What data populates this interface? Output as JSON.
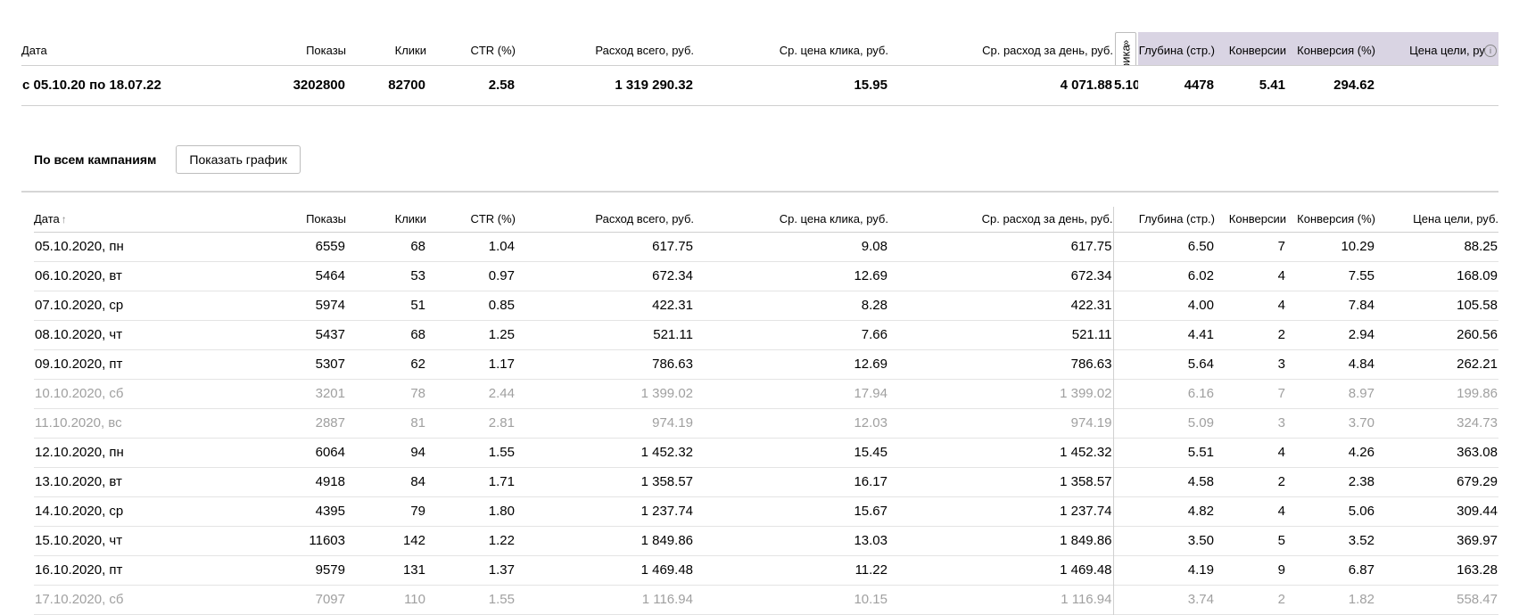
{
  "columns": {
    "date": "Дата",
    "shows": "Показы",
    "clicks": "Клики",
    "ctr": "CTR (%)",
    "spend": "Расход всего, руб.",
    "cpc": "Ср. цена клика, руб.",
    "daily_spend": "Ср. расход за день, руб.",
    "depth": "Глубина (стр.)",
    "conversions": "Конверсии",
    "conv_rate": "Конверсия (%)",
    "goal_price": "Цена цели, руб."
  },
  "metrika_tab": {
    "label": "Метрика",
    "arrow": "»"
  },
  "summary": {
    "period": "с 05.10.20 по 18.07.22",
    "shows": "3202800",
    "clicks": "82700",
    "ctr": "2.58",
    "spend": "1 319 290.32",
    "cpc": "15.95",
    "daily_spend": "4 071.88",
    "depth": "5.10",
    "conversions": "4478",
    "conv_rate": "5.41",
    "goal_price": "294.62"
  },
  "section": {
    "title": "По всем кампаниям",
    "show_chart_label": "Показать график",
    "sort_arrow": "↑"
  },
  "info_icon": "i",
  "rows": [
    {
      "date": "05.10.2020, пн",
      "shows": "6559",
      "clicks": "68",
      "ctr": "1.04",
      "spend": "617.75",
      "cpc": "9.08",
      "daily_spend": "617.75",
      "depth": "6.50",
      "conversions": "7",
      "conv_rate": "10.29",
      "goal_price": "88.25",
      "weekend": false
    },
    {
      "date": "06.10.2020, вт",
      "shows": "5464",
      "clicks": "53",
      "ctr": "0.97",
      "spend": "672.34",
      "cpc": "12.69",
      "daily_spend": "672.34",
      "depth": "6.02",
      "conversions": "4",
      "conv_rate": "7.55",
      "goal_price": "168.09",
      "weekend": false
    },
    {
      "date": "07.10.2020, ср",
      "shows": "5974",
      "clicks": "51",
      "ctr": "0.85",
      "spend": "422.31",
      "cpc": "8.28",
      "daily_spend": "422.31",
      "depth": "4.00",
      "conversions": "4",
      "conv_rate": "7.84",
      "goal_price": "105.58",
      "weekend": false
    },
    {
      "date": "08.10.2020, чт",
      "shows": "5437",
      "clicks": "68",
      "ctr": "1.25",
      "spend": "521.11",
      "cpc": "7.66",
      "daily_spend": "521.11",
      "depth": "4.41",
      "conversions": "2",
      "conv_rate": "2.94",
      "goal_price": "260.56",
      "weekend": false
    },
    {
      "date": "09.10.2020, пт",
      "shows": "5307",
      "clicks": "62",
      "ctr": "1.17",
      "spend": "786.63",
      "cpc": "12.69",
      "daily_spend": "786.63",
      "depth": "5.64",
      "conversions": "3",
      "conv_rate": "4.84",
      "goal_price": "262.21",
      "weekend": false
    },
    {
      "date": "10.10.2020, сб",
      "shows": "3201",
      "clicks": "78",
      "ctr": "2.44",
      "spend": "1 399.02",
      "cpc": "17.94",
      "daily_spend": "1 399.02",
      "depth": "6.16",
      "conversions": "7",
      "conv_rate": "8.97",
      "goal_price": "199.86",
      "weekend": true
    },
    {
      "date": "11.10.2020, вс",
      "shows": "2887",
      "clicks": "81",
      "ctr": "2.81",
      "spend": "974.19",
      "cpc": "12.03",
      "daily_spend": "974.19",
      "depth": "5.09",
      "conversions": "3",
      "conv_rate": "3.70",
      "goal_price": "324.73",
      "weekend": true
    },
    {
      "date": "12.10.2020, пн",
      "shows": "6064",
      "clicks": "94",
      "ctr": "1.55",
      "spend": "1 452.32",
      "cpc": "15.45",
      "daily_spend": "1 452.32",
      "depth": "5.51",
      "conversions": "4",
      "conv_rate": "4.26",
      "goal_price": "363.08",
      "weekend": false
    },
    {
      "date": "13.10.2020, вт",
      "shows": "4918",
      "clicks": "84",
      "ctr": "1.71",
      "spend": "1 358.57",
      "cpc": "16.17",
      "daily_spend": "1 358.57",
      "depth": "4.58",
      "conversions": "2",
      "conv_rate": "2.38",
      "goal_price": "679.29",
      "weekend": false
    },
    {
      "date": "14.10.2020, ср",
      "shows": "4395",
      "clicks": "79",
      "ctr": "1.80",
      "spend": "1 237.74",
      "cpc": "15.67",
      "daily_spend": "1 237.74",
      "depth": "4.82",
      "conversions": "4",
      "conv_rate": "5.06",
      "goal_price": "309.44",
      "weekend": false
    },
    {
      "date": "15.10.2020, чт",
      "shows": "11603",
      "clicks": "142",
      "ctr": "1.22",
      "spend": "1 849.86",
      "cpc": "13.03",
      "daily_spend": "1 849.86",
      "depth": "3.50",
      "conversions": "5",
      "conv_rate": "3.52",
      "goal_price": "369.97",
      "weekend": false
    },
    {
      "date": "16.10.2020, пт",
      "shows": "9579",
      "clicks": "131",
      "ctr": "1.37",
      "spend": "1 469.48",
      "cpc": "11.22",
      "daily_spend": "1 469.48",
      "depth": "4.19",
      "conversions": "9",
      "conv_rate": "6.87",
      "goal_price": "163.28",
      "weekend": false
    },
    {
      "date": "17.10.2020, сб",
      "shows": "7097",
      "clicks": "110",
      "ctr": "1.55",
      "spend": "1 116.94",
      "cpc": "10.15",
      "daily_spend": "1 116.94",
      "depth": "3.74",
      "conversions": "2",
      "conv_rate": "1.82",
      "goal_price": "558.47",
      "weekend": true
    }
  ]
}
